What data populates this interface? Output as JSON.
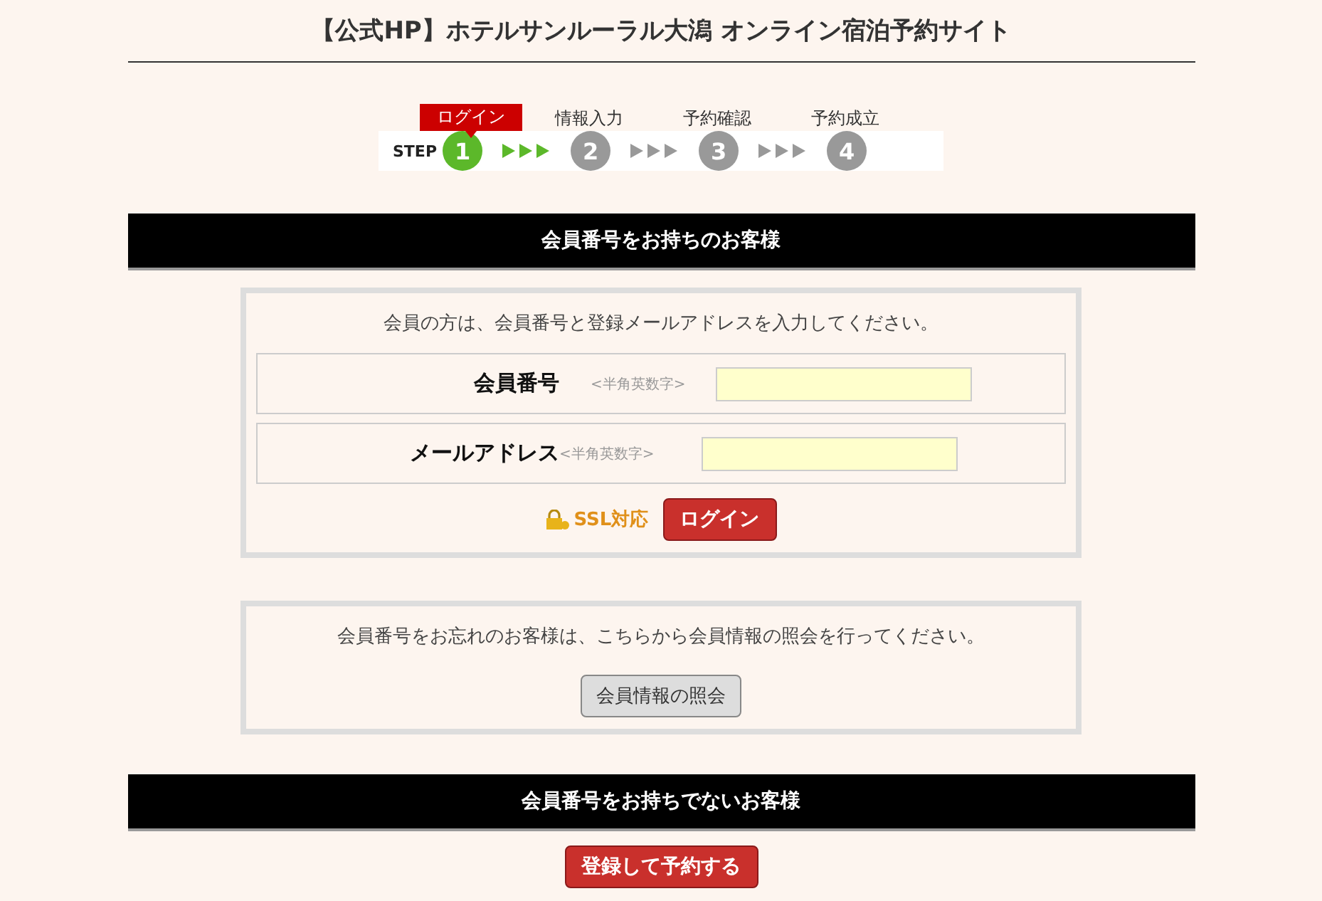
{
  "title": "【公式HP】ホテルサンルーラル大潟 オンライン宿泊予約サイト",
  "steps": {
    "prefix": "STEP",
    "items": [
      {
        "label": "ログイン",
        "number": "1",
        "selected": true
      },
      {
        "label": "情報入力",
        "number": "2",
        "selected": false
      },
      {
        "label": "予約確認",
        "number": "3",
        "selected": false
      },
      {
        "label": "予約成立",
        "number": "4",
        "selected": false
      }
    ]
  },
  "member_section": {
    "heading": "会員番号をお持ちのお客様",
    "intro": "会員の方は、会員番号と登録メールアドレスを入力してください。",
    "fields": [
      {
        "label": "会員番号",
        "hint": "<半角英数字>"
      },
      {
        "label": "メールアドレス",
        "hint": "<半角英数字>"
      }
    ],
    "ssl": "SSL対応",
    "login_button": "ログイン"
  },
  "forgot": {
    "text": "会員番号をお忘れのお客様は、こちらから会員情報の照会を行ってください。",
    "button": "会員情報の照会"
  },
  "guest_section": {
    "heading": "会員番号をお持ちでないお客様",
    "button": "登録して予約する"
  }
}
